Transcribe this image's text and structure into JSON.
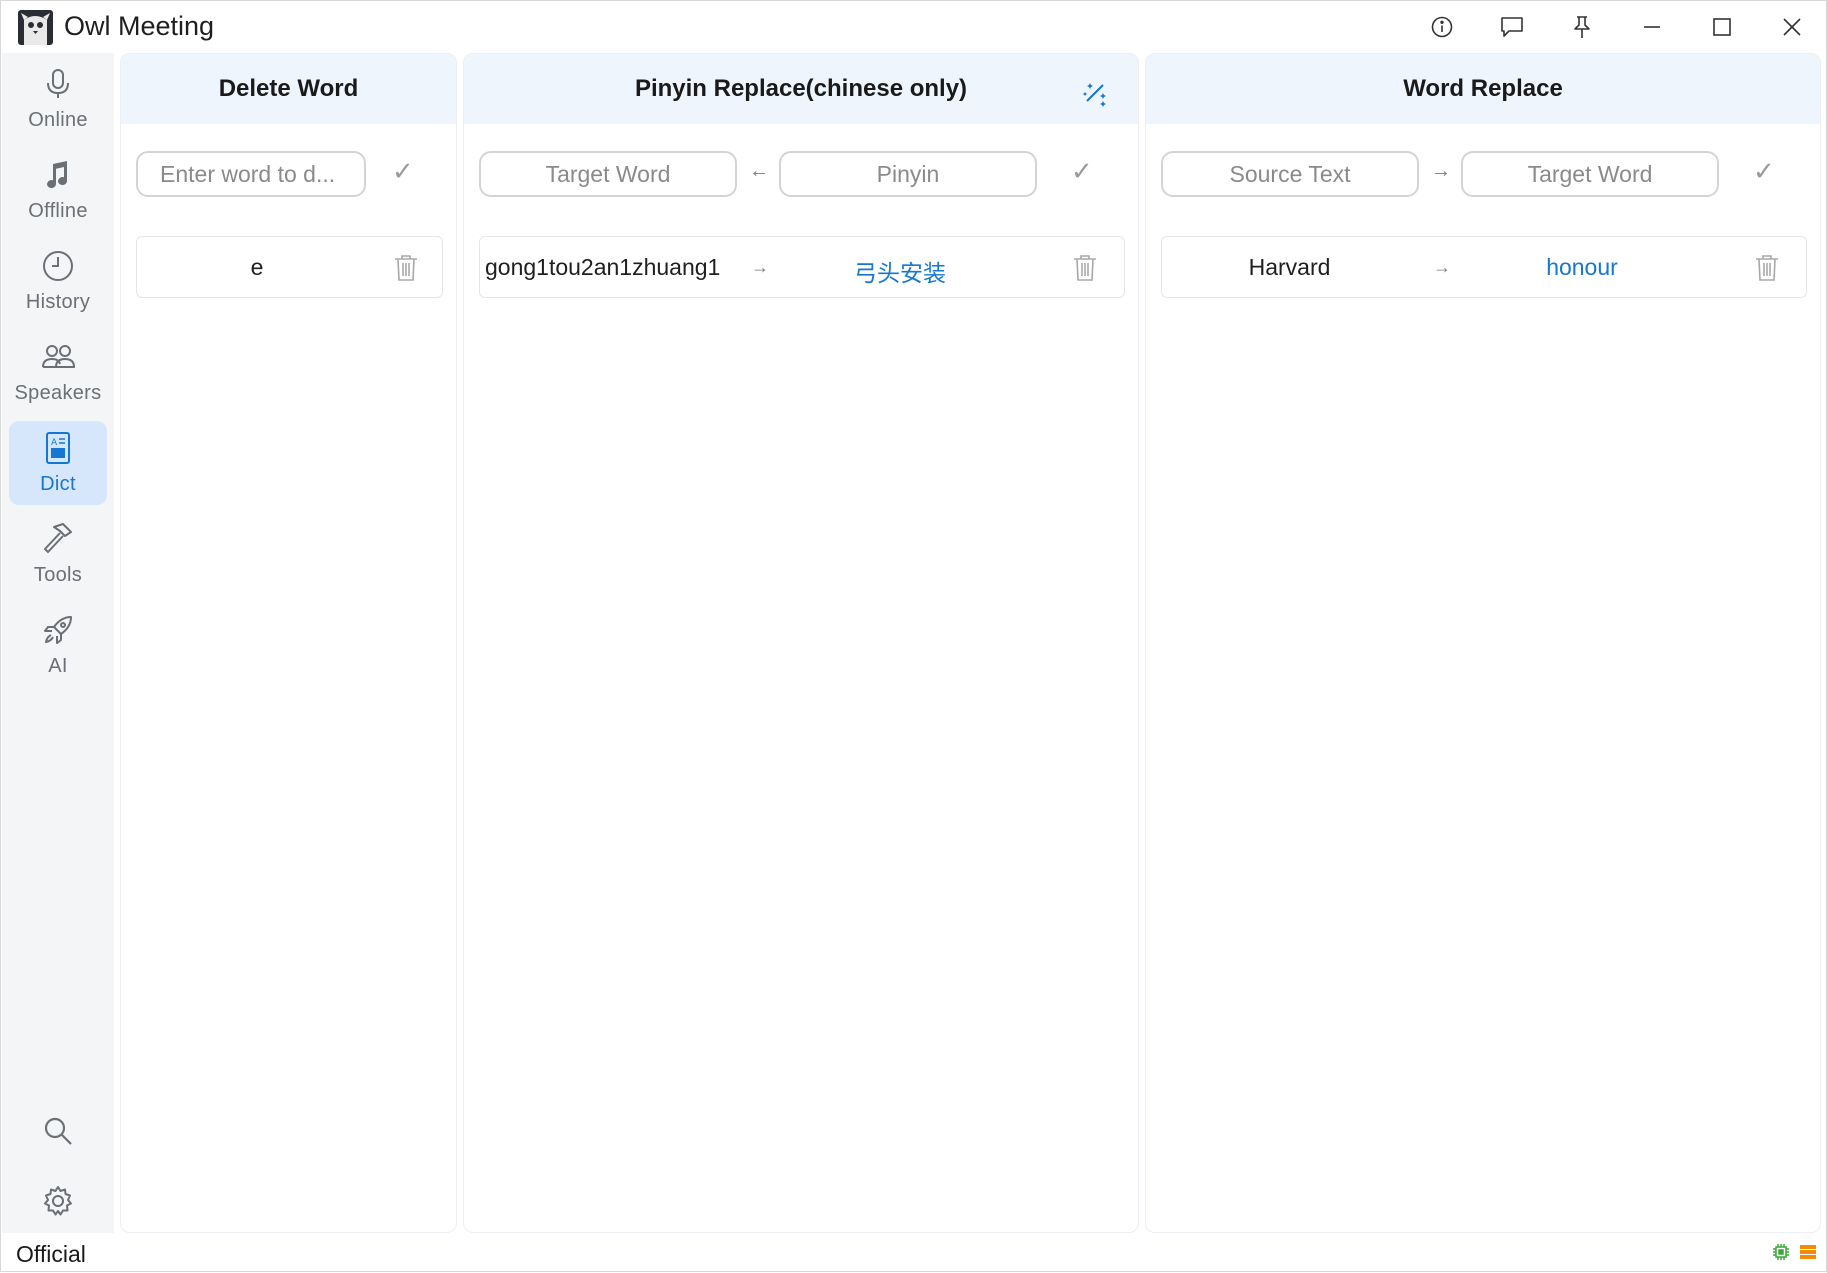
{
  "app": {
    "title": "Owl Meeting"
  },
  "sidebar": {
    "items": [
      {
        "label": "Online",
        "icon": "microphone-icon"
      },
      {
        "label": "Offline",
        "icon": "music-note-icon"
      },
      {
        "label": "History",
        "icon": "clock-icon"
      },
      {
        "label": "Speakers",
        "icon": "people-icon"
      },
      {
        "label": "Dict",
        "icon": "dictionary-icon",
        "active": true
      },
      {
        "label": "Tools",
        "icon": "hammer-icon"
      },
      {
        "label": "AI",
        "icon": "rocket-icon"
      }
    ],
    "bottom": [
      "search-icon",
      "settings-icon"
    ]
  },
  "delete_word": {
    "title": "Delete Word",
    "input_placeholder": "Enter word to d...",
    "entries": [
      {
        "word": "e"
      }
    ]
  },
  "pinyin_replace": {
    "title": "Pinyin Replace(chinese only)",
    "target_placeholder": "Target Word",
    "arrow": "←",
    "pinyin_placeholder": "Pinyin",
    "entries": [
      {
        "pinyin": "gong1tou2an1zhuang1",
        "arrow": "→",
        "target": "弓头安装"
      }
    ]
  },
  "word_replace": {
    "title": "Word Replace",
    "source_placeholder": "Source Text",
    "arrow": "→",
    "target_placeholder": "Target Word",
    "entries": [
      {
        "source": "Harvard",
        "arrow": "→",
        "target": "honour"
      }
    ]
  },
  "status": {
    "text": "Official"
  },
  "colors": {
    "accent": "#1677d2",
    "active_bg": "#d6e7fb",
    "header_bg": "#eef5fd",
    "sidebar_bg": "#f4f5f7"
  }
}
